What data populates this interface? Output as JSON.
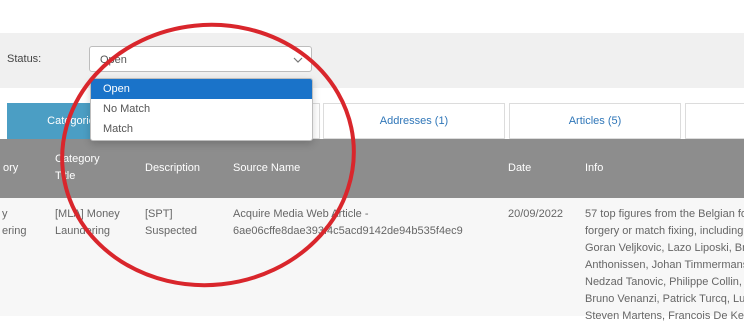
{
  "status": {
    "label": "Status:",
    "selected": "Open",
    "options": [
      "Open",
      "No Match",
      "Match"
    ]
  },
  "tabs": [
    {
      "label": "Categories (3)",
      "active": true
    },
    {
      "label": "",
      "active": false
    },
    {
      "label": "Addresses (1)",
      "active": false
    },
    {
      "label": "Articles (5)",
      "active": false
    },
    {
      "label": "",
      "active": false
    }
  ],
  "table": {
    "headers": {
      "category": "ory",
      "category_title_1": "Category",
      "category_title_2": "Title",
      "description": "Description",
      "source_name": "Source Name",
      "date": "Date",
      "info": "Info"
    },
    "row": {
      "category_1": "y",
      "category_2": "ering",
      "category_title_1": "[MLA] Money",
      "category_title_2": "Laundering",
      "description_1": "[SPT]",
      "description_2": "Suspected",
      "source_name_1": "Acquire Media Web Article -",
      "source_name_2": "6ae06cffe8dae393f4c5acd9142de94b535f4ec9",
      "date": "20/09/2022",
      "info_lines": [
        "57 top figures from the Belgian fo",
        "forgery or match fixing, including",
        "Goran Veljkovic, Lazo Liposki, Bra",
        "Anthonissen, Johan Timmermans",
        "Nedzad Tanovic, Philippe Collin,",
        "Bruno Venanzi, Patrick Turcq, Luc",
        "Steven Martens, Francois De Kee"
      ]
    }
  },
  "colors": {
    "active_tab": "#4b9ec4",
    "selected_option": "#1a73c9",
    "header_bg": "#8d8d8d",
    "annotation": "#d9262c"
  }
}
